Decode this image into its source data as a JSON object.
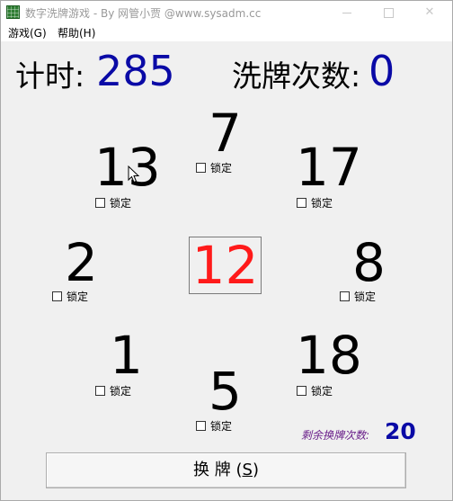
{
  "window": {
    "title": "数字洗牌游戏 - By 网管小贾 @www.sysadm.cc"
  },
  "menu": {
    "game": "游戏(G)",
    "help": "帮助(H)"
  },
  "stats": {
    "timer_label": "计时:",
    "timer_value": "285",
    "shuffle_count_label": "洗牌次数:",
    "shuffle_count_value": "0"
  },
  "cards": {
    "top": {
      "value": "7",
      "lock_label": "锁定",
      "locked": false
    },
    "upper_left": {
      "value": "13",
      "lock_label": "锁定",
      "locked": false
    },
    "upper_right": {
      "value": "17",
      "lock_label": "锁定",
      "locked": false
    },
    "left": {
      "value": "2",
      "lock_label": "锁定",
      "locked": false
    },
    "center": {
      "value": "12"
    },
    "right": {
      "value": "8",
      "lock_label": "锁定",
      "locked": false
    },
    "lower_left": {
      "value": "1",
      "lock_label": "锁定",
      "locked": false
    },
    "lower_right": {
      "value": "18",
      "lock_label": "锁定",
      "locked": false
    },
    "bottom": {
      "value": "5",
      "lock_label": "锁定",
      "locked": false
    }
  },
  "remaining": {
    "label": "剩余换牌次数:",
    "value": "20"
  },
  "button": {
    "label_main": "换 牌 (",
    "label_key": "S",
    "label_end": ")"
  },
  "colors": {
    "value_blue": "#0a0aa6",
    "center_red": "#ff1a1a",
    "remain_purple": "#6a1f8a"
  }
}
